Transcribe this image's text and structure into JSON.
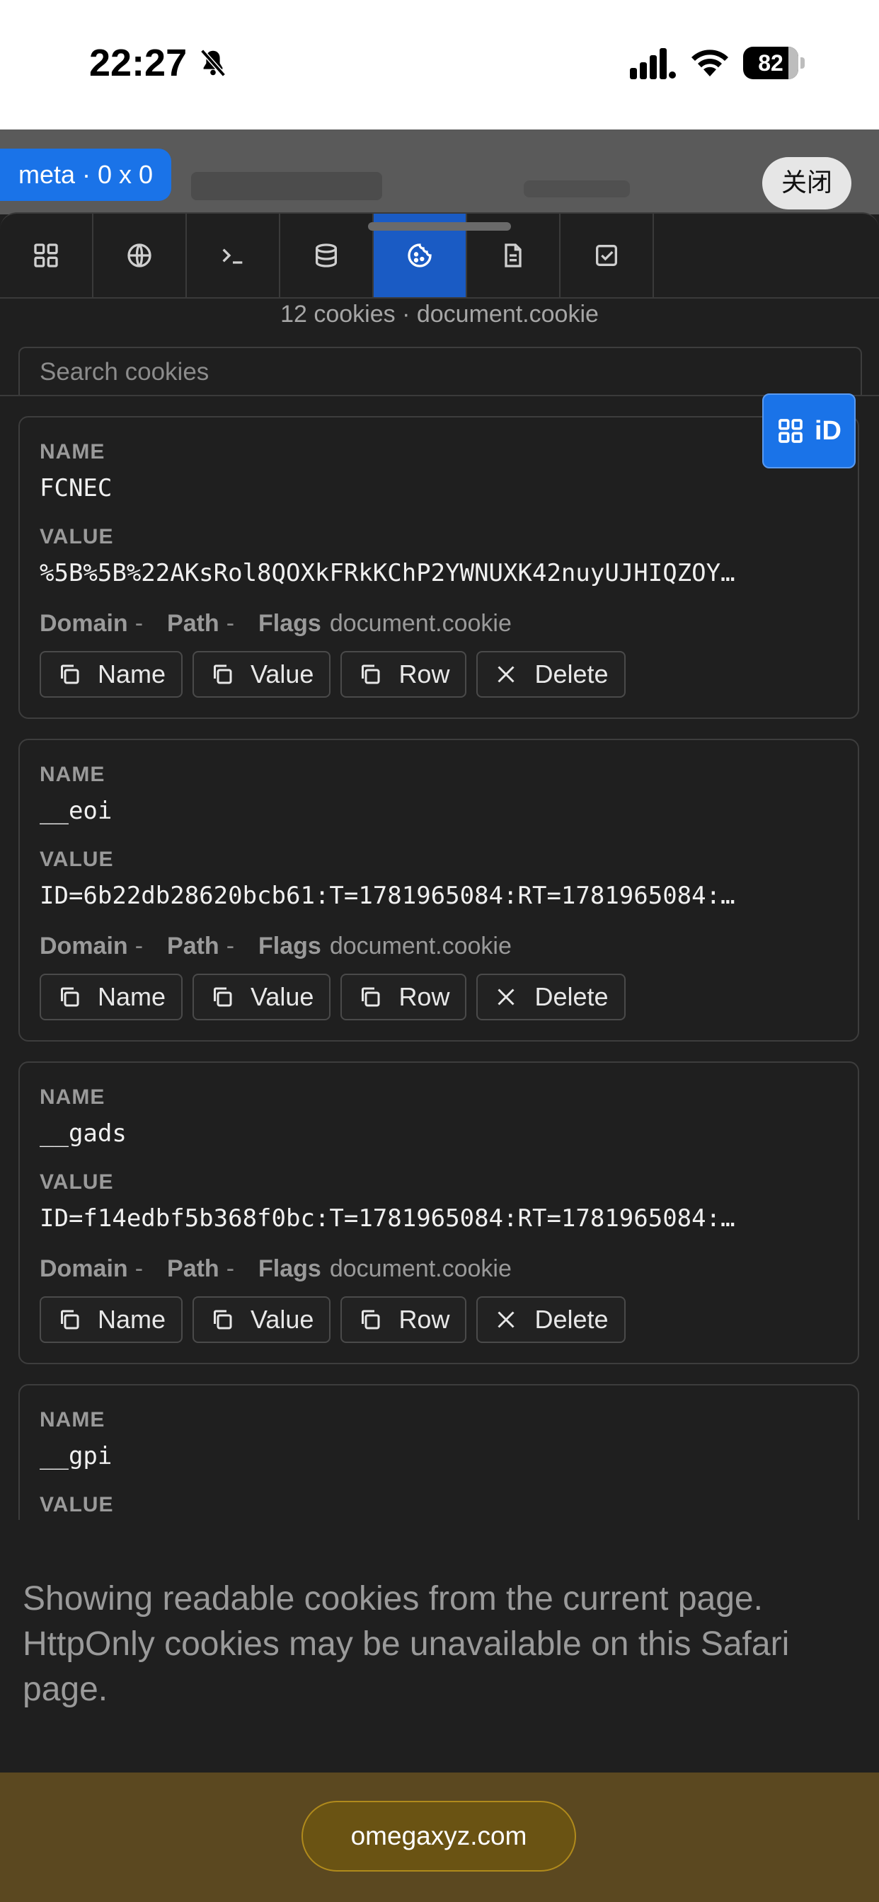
{
  "status_bar": {
    "time": "22:27",
    "battery": "82",
    "battery_level": 0.82
  },
  "overlay": {
    "meta_badge": "meta · 0 x 0",
    "close_label": "关闭"
  },
  "tabs": [
    {
      "icon": "grid-icon",
      "active": false
    },
    {
      "icon": "globe-icon",
      "active": false
    },
    {
      "icon": "terminal-icon",
      "active": false
    },
    {
      "icon": "database-icon",
      "active": false
    },
    {
      "icon": "cookie-icon",
      "active": true
    },
    {
      "icon": "document-icon",
      "active": false
    },
    {
      "icon": "checkbox-icon",
      "active": false
    }
  ],
  "cookies_header": {
    "count": "12 cookies",
    "separator": "·",
    "source": "document.cookie"
  },
  "search": {
    "placeholder": "Search cookies",
    "value": ""
  },
  "id_button": {
    "label": "iD"
  },
  "labels": {
    "name": "NAME",
    "value": "VALUE",
    "domain": "Domain",
    "path": "Path",
    "flags": "Flags",
    "dash": "-"
  },
  "buttons": {
    "name": "Name",
    "value": "Value",
    "row": "Row",
    "delete": "Delete"
  },
  "cookies": [
    {
      "name": "FCNEC",
      "value": "%5B%5B%22AKsRol8QOXkFRkKChP2YWNUXK42nuyUJHIQZOY…",
      "flags": "document.cookie"
    },
    {
      "name": "__eoi",
      "value": "ID=6b22db28620bcb61:T=1781965084:RT=1781965084:…",
      "flags": "document.cookie"
    },
    {
      "name": "__gads",
      "value": "ID=f14edbf5b368f0bc:T=1781965084:RT=1781965084:…",
      "flags": "document.cookie"
    },
    {
      "name": "__gpi",
      "value": "",
      "flags": ""
    }
  ],
  "footer_note": "Showing readable cookies from the current page. HttpOnly cookies may be unavailable on this Safari page.",
  "bottom_bar": {
    "url": "omegaxyz.com"
  },
  "colors": {
    "accent": "#1a73e8",
    "panel_bg": "#1f1f1f",
    "url_bar": "#5b4820"
  }
}
